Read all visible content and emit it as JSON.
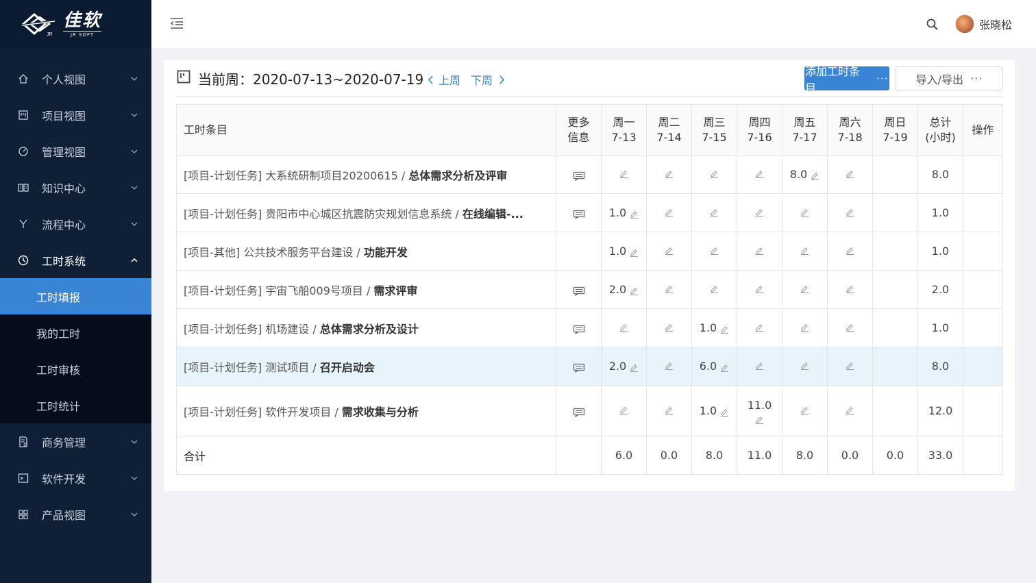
{
  "app": {
    "logo_cn": "佳软",
    "logo_en": "JR SOFT",
    "logo_small": "JR"
  },
  "sidebar": {
    "items": [
      {
        "label": "个人视图",
        "icon": "home-icon"
      },
      {
        "label": "项目视图",
        "icon": "project-board-icon"
      },
      {
        "label": "管理视图",
        "icon": "dashboard-gauge-icon"
      },
      {
        "label": "知识中心",
        "icon": "book-icon"
      },
      {
        "label": "流程中心",
        "icon": "flow-branch-icon"
      },
      {
        "label": "工时系统",
        "icon": "clock-icon",
        "open": true
      },
      {
        "label": "商务管理",
        "icon": "document-icon"
      },
      {
        "label": "软件开发",
        "icon": "terminal-icon"
      },
      {
        "label": "产品视图",
        "icon": "grid-icon"
      }
    ],
    "submenu": [
      {
        "label": "工时填报",
        "active": true
      },
      {
        "label": "我的工时"
      },
      {
        "label": "工时审核"
      },
      {
        "label": "工时统计"
      }
    ]
  },
  "header": {
    "user_name": "张晓松"
  },
  "toolbar": {
    "title": "当前周：2020-07-13~2020-07-19",
    "prev_label": "上周",
    "next_label": "下周",
    "add_button": "添加工时条目",
    "import_button": "导入/导出",
    "dots": "···"
  },
  "table": {
    "headers": {
      "task": "工时条目",
      "more_1": "更多",
      "more_2": "信息",
      "days": [
        {
          "day": "周一",
          "date": "7-13"
        },
        {
          "day": "周二",
          "date": "7-14"
        },
        {
          "day": "周三",
          "date": "7-15"
        },
        {
          "day": "周四",
          "date": "7-16"
        },
        {
          "day": "周五",
          "date": "7-17"
        },
        {
          "day": "周六",
          "date": "7-18"
        },
        {
          "day": "周日",
          "date": "7-19"
        }
      ],
      "total_1": "总计",
      "total_2": "(小时)",
      "action": "操作"
    },
    "rows": [
      {
        "prefix": "[项目-计划任务] 大系统研制项目20200615 / ",
        "bold": "总体需求分析及评审",
        "msg": true,
        "values": [
          "",
          "",
          "",
          "",
          "8.0",
          "",
          ""
        ],
        "total": "8.0"
      },
      {
        "prefix": "[项目-计划任务] 贵阳市中心城区抗震防灾规划信息系统 / ",
        "bold": "在线编辑-...",
        "msg": true,
        "values": [
          "1.0",
          "",
          "",
          "",
          "",
          "",
          ""
        ],
        "total": "1.0"
      },
      {
        "prefix": "[项目-其他] 公共技术服务平台建设 / ",
        "bold": "功能开发",
        "msg": false,
        "values": [
          "1.0",
          "",
          "",
          "",
          "",
          "",
          ""
        ],
        "total": "1.0"
      },
      {
        "prefix": "[项目-计划任务] 宇宙飞船009号项目 / ",
        "bold": "需求评审",
        "msg": true,
        "values": [
          "2.0",
          "",
          "",
          "",
          "",
          "",
          ""
        ],
        "total": "2.0"
      },
      {
        "prefix": "[项目-计划任务] 机场建设 / ",
        "bold": "总体需求分析及设计",
        "msg": true,
        "values": [
          "",
          "",
          "1.0",
          "",
          "",
          "",
          ""
        ],
        "total": "1.0"
      },
      {
        "prefix": "[项目-计划任务] 测试项目 / ",
        "bold": "召开启动会",
        "msg": true,
        "values": [
          "2.0",
          "",
          "6.0",
          "",
          "",
          "",
          ""
        ],
        "total": "8.0",
        "highlight": true
      },
      {
        "prefix": "[项目-计划任务] 软件开发项目 / ",
        "bold": "需求收集与分析",
        "msg": true,
        "values": [
          "",
          "",
          "1.0",
          "11.0",
          "",
          "",
          ""
        ],
        "total": "12.0",
        "tall": true
      }
    ],
    "footer": {
      "label": "合计",
      "values": [
        "6.0",
        "0.0",
        "8.0",
        "11.0",
        "8.0",
        "0.0",
        "0.0"
      ],
      "total": "33.0"
    }
  },
  "colors": {
    "primary": "#3a84d4",
    "sidebar_bg": "#0e1f36",
    "submenu_bg": "#050d1a",
    "row_highlight": "#e8f4fc"
  }
}
